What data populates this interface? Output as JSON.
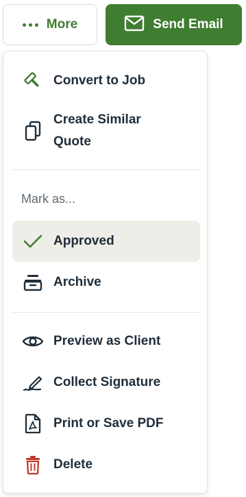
{
  "toolbar": {
    "more_label": "More",
    "send_label": "Send Email"
  },
  "menu": {
    "convert_to_job": "Convert to Job",
    "create_similar_line1": "Create Similar",
    "create_similar_line2": "Quote",
    "mark_as_label": "Mark as...",
    "approved": "Approved",
    "archive": "Archive",
    "preview_as_client": "Preview as Client",
    "collect_signature": "Collect Signature",
    "print_or_save_pdf": "Print or Save PDF",
    "delete": "Delete"
  },
  "colors": {
    "brand_green": "#3f7d31",
    "text_dark": "#1f2d3a",
    "muted": "#5e6a73",
    "danger": "#c0392b",
    "selected_bg": "#eeede7"
  },
  "icons": {
    "more": "more-dots-icon",
    "send": "envelope-icon",
    "convert": "hammer-icon",
    "create_similar": "copy-icon",
    "approved": "check-icon",
    "archive": "archive-box-icon",
    "preview": "eye-icon",
    "signature": "pen-signature-icon",
    "pdf": "pdf-file-icon",
    "delete": "trash-icon"
  }
}
